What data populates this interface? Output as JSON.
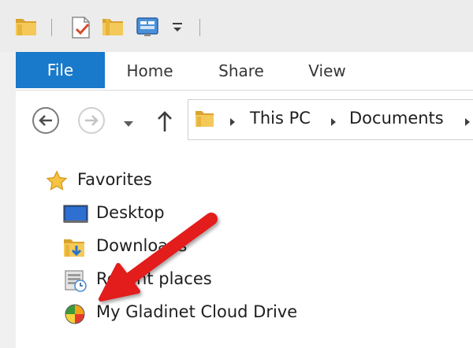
{
  "ribbon": {
    "tabs": [
      {
        "label": "File"
      },
      {
        "label": "Home"
      },
      {
        "label": "Share"
      },
      {
        "label": "View"
      }
    ]
  },
  "address": {
    "crumbs": [
      "This PC",
      "Documents"
    ]
  },
  "nav_pane": {
    "favorites_label": "Favorites",
    "items": [
      {
        "label": "Desktop",
        "icon": "desktop-icon"
      },
      {
        "label": "Downloads",
        "icon": "downloads-folder-icon"
      },
      {
        "label": "Recent places",
        "icon": "recent-places-icon"
      },
      {
        "label": "My Gladinet Cloud Drive",
        "icon": "gladinet-cloud-icon"
      }
    ]
  },
  "colors": {
    "file_tab": "#1979ca",
    "annotation_arrow": "#e31b1b",
    "folder": "#e8b53c"
  }
}
